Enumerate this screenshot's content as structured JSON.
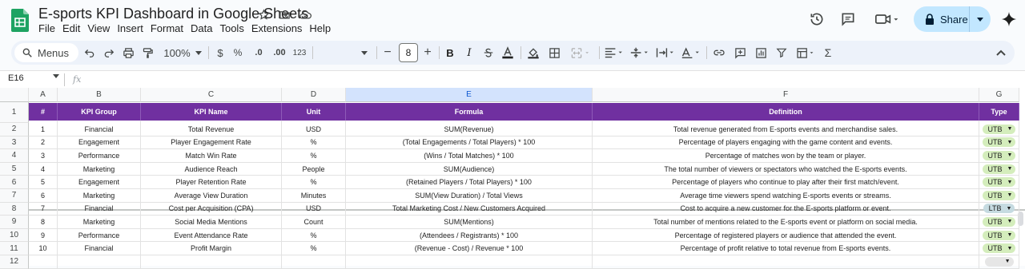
{
  "app": {
    "doc_title": "E-sports KPI Dashboard in Google Sheets",
    "menu": [
      "File",
      "Edit",
      "View",
      "Insert",
      "Format",
      "Data",
      "Tools",
      "Extensions",
      "Help"
    ],
    "share_label": "Share"
  },
  "toolbar": {
    "menus_label": "Menus",
    "zoom": "100%",
    "currency": "$",
    "percent": "%",
    "dec_decrease": ".0",
    "dec_increase": ".00",
    "number_format": "123",
    "font_size": "8",
    "bold": "B",
    "italic": "I"
  },
  "formula_bar": {
    "name_box": "E16",
    "fx": "fx",
    "value": ""
  },
  "columns": [
    "A",
    "B",
    "C",
    "D",
    "E",
    "F",
    "G"
  ],
  "row_numbers": [
    "1",
    "2",
    "3",
    "4",
    "5",
    "6",
    "7",
    "8",
    "9",
    "10",
    "11",
    "12"
  ],
  "table": {
    "headers": [
      "#",
      "KPI Group",
      "KPI Name",
      "Unit",
      "Formula",
      "Definition",
      "Type"
    ],
    "rows": [
      [
        "1",
        "Financial",
        "Total Revenue",
        "USD",
        "SUM(Revenue)",
        "Total revenue generated from E-sports events and merchandise sales.",
        "UTB"
      ],
      [
        "2",
        "Engagement",
        "Player Engagement Rate",
        "%",
        "(Total Engagements / Total Players) * 100",
        "Percentage of players engaging with the game content and events.",
        "UTB"
      ],
      [
        "3",
        "Performance",
        "Match Win Rate",
        "%",
        "(Wins / Total Matches) * 100",
        "Percentage of matches won by the team or player.",
        "UTB"
      ],
      [
        "4",
        "Marketing",
        "Audience Reach",
        "People",
        "SUM(Audience)",
        "The total number of viewers or spectators who watched the E-sports events.",
        "UTB"
      ],
      [
        "5",
        "Engagement",
        "Player Retention Rate",
        "%",
        "(Retained Players / Total Players) * 100",
        "Percentage of players who continue to play after their first match/event.",
        "UTB"
      ],
      [
        "6",
        "Marketing",
        "Average View Duration",
        "Minutes",
        "SUM(View Duration) / Total Views",
        "Average time viewers spend watching E-sports events or streams.",
        "UTB"
      ],
      [
        "7",
        "Financial",
        "Cost per Acquisition (CPA)",
        "USD",
        "Total Marketing Cost / New Customers Acquired",
        "Cost to acquire a new customer for the E-sports platform or event.",
        "LTB"
      ],
      [
        "8",
        "Marketing",
        "Social Media Mentions",
        "Count",
        "SUM(Mentions)",
        "Total number of mentions related to the E-sports event or platform on social media.",
        "UTB"
      ],
      [
        "9",
        "Performance",
        "Event Attendance Rate",
        "%",
        "(Attendees / Registrants) * 100",
        "Percentage of registered players or audience that attended the event.",
        "UTB"
      ],
      [
        "10",
        "Financial",
        "Profit Margin",
        "%",
        "(Revenue - Cost) / Revenue * 100",
        "Percentage of profit relative to total revenue from E-sports events.",
        "UTB"
      ]
    ]
  },
  "colors": {
    "header_bg": "#7030a0",
    "utb_chip": "#d4edbc",
    "ltb_chip": "#c6dbe1",
    "share_bg": "#c2e7ff",
    "selected_col": "#d3e3fd"
  }
}
